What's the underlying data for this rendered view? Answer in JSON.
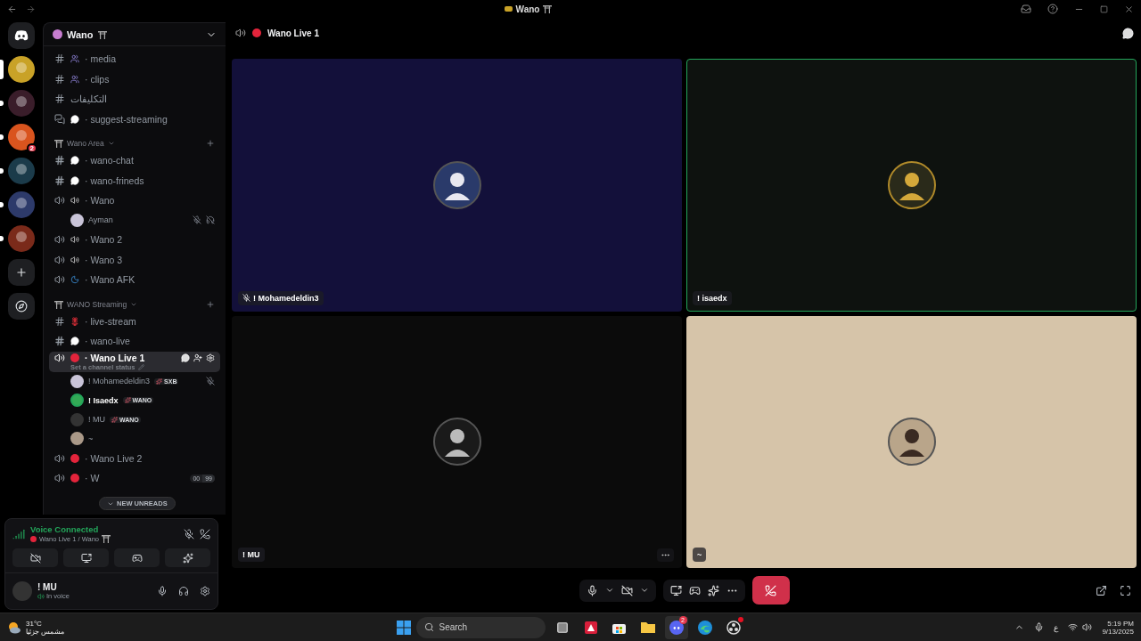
{
  "titlebar": {
    "title": "Wano"
  },
  "servers": [
    {
      "selected": true,
      "unread": false,
      "color": "#c9a227"
    },
    {
      "selected": false,
      "unread": true,
      "color": "#3a1d2a"
    },
    {
      "selected": false,
      "unread": true,
      "badge": "2",
      "color": "#d9541e"
    },
    {
      "selected": false,
      "unread": true,
      "color": "#1b3b4a"
    },
    {
      "selected": false,
      "unread": true,
      "color": "#2d3a6a"
    },
    {
      "selected": false,
      "unread": true,
      "color": "#7a2a1a"
    }
  ],
  "server": {
    "name": "Wano"
  },
  "channels": [
    {
      "kind": "text",
      "emoji": {
        "kind": "people"
      },
      "name": "· media",
      "selected": false
    },
    {
      "kind": "text",
      "emoji": {
        "kind": "people"
      },
      "name": "· clips",
      "selected": false
    },
    {
      "kind": "text",
      "name": "التكليفات",
      "selected": false
    },
    {
      "kind": "forum",
      "emoji": {
        "kind": "speech"
      },
      "name": "· suggest-streaming",
      "selected": false
    },
    {
      "kind": "category",
      "name": "Wano Area"
    },
    {
      "kind": "thread",
      "emoji": {
        "kind": "speech"
      },
      "name": "· wano-chat",
      "selected": false
    },
    {
      "kind": "thread",
      "emoji": {
        "kind": "speech"
      },
      "name": "· wano-frineds",
      "selected": false
    },
    {
      "kind": "voice",
      "emoji": {
        "kind": "speaker"
      },
      "name": "· Wano",
      "selected": false,
      "members": [
        {
          "name": "Ayman",
          "speaking": false,
          "muted": true,
          "deafened": true
        }
      ]
    },
    {
      "kind": "voice",
      "emoji": {
        "kind": "speaker"
      },
      "name": "· Wano 2",
      "selected": false
    },
    {
      "kind": "voice",
      "emoji": {
        "kind": "speaker"
      },
      "name": "· Wano 3",
      "selected": false
    },
    {
      "kind": "voice",
      "emoji": {
        "kind": "sleep"
      },
      "name": "· Wano AFK",
      "selected": false
    },
    {
      "kind": "category",
      "name": "WANO Streaming"
    },
    {
      "kind": "text",
      "emoji": {
        "kind": "rose"
      },
      "name": "· live-stream",
      "selected": false
    },
    {
      "kind": "thread",
      "emoji": {
        "kind": "speech"
      },
      "name": "· wano-live",
      "selected": false
    },
    {
      "kind": "voice",
      "emoji": {
        "kind": "live"
      },
      "name": "· Wano Live 1",
      "selected": true,
      "status": "Set a channel status",
      "members": [
        {
          "name": "! Mohamedeldin3",
          "speaking": false,
          "muted": true,
          "deafened": false,
          "tag": "SXB"
        },
        {
          "name": "! Isaedx",
          "speaking": true,
          "muted": false,
          "deafened": false,
          "tag": "WANO"
        },
        {
          "name": "! MU",
          "speaking": false,
          "muted": false,
          "deafened": false,
          "tag": "WANO"
        },
        {
          "name": "~",
          "speaking": false,
          "muted": false,
          "deafened": false
        }
      ]
    },
    {
      "kind": "voice",
      "emoji": {
        "kind": "live"
      },
      "name": "· Wano Live 2",
      "selected": false
    },
    {
      "kind": "voice",
      "emoji": {
        "kind": "live"
      },
      "name": "· W",
      "selected": false,
      "limit": [
        "00",
        "99"
      ]
    }
  ],
  "new_unreads": "NEW UNREADS",
  "voice": {
    "status": "Voice Connected",
    "channel": "Wano Live 1 / Wano"
  },
  "user": {
    "name": "! MU",
    "status": "In voice"
  },
  "call": {
    "channel": "Wano Live 1"
  },
  "tiles": [
    {
      "name": "! Mohamedeldin3",
      "speaking": false,
      "muted": true,
      "hovered": false,
      "color": "#13103a"
    },
    {
      "name": "! isaedx",
      "speaking": true,
      "muted": false,
      "hovered": false,
      "color": "#0e120f"
    },
    {
      "name": "! MU",
      "speaking": false,
      "muted": false,
      "hovered": true,
      "color": "#0b0b0b"
    },
    {
      "name": "~",
      "speaking": false,
      "muted": false,
      "hovered": false,
      "color": "#d6c4a9"
    }
  ],
  "weather": {
    "temp": "31°C",
    "condition": "مشمس جزئيا"
  },
  "taskbar": {
    "search": {
      "placeholder": "Search"
    },
    "apps": [
      {
        "kind": "taskview",
        "active": false
      },
      {
        "kind": "amd",
        "active": false
      },
      {
        "kind": "store",
        "active": false
      },
      {
        "kind": "files",
        "active": false
      },
      {
        "kind": "discord",
        "badge": "2",
        "active": true
      },
      {
        "kind": "edge",
        "active": false
      },
      {
        "kind": "obs",
        "dot": true,
        "active": false
      }
    ]
  },
  "tray": {
    "language": "ع",
    "time": "5:19 PM",
    "date": "9/13/2025"
  }
}
